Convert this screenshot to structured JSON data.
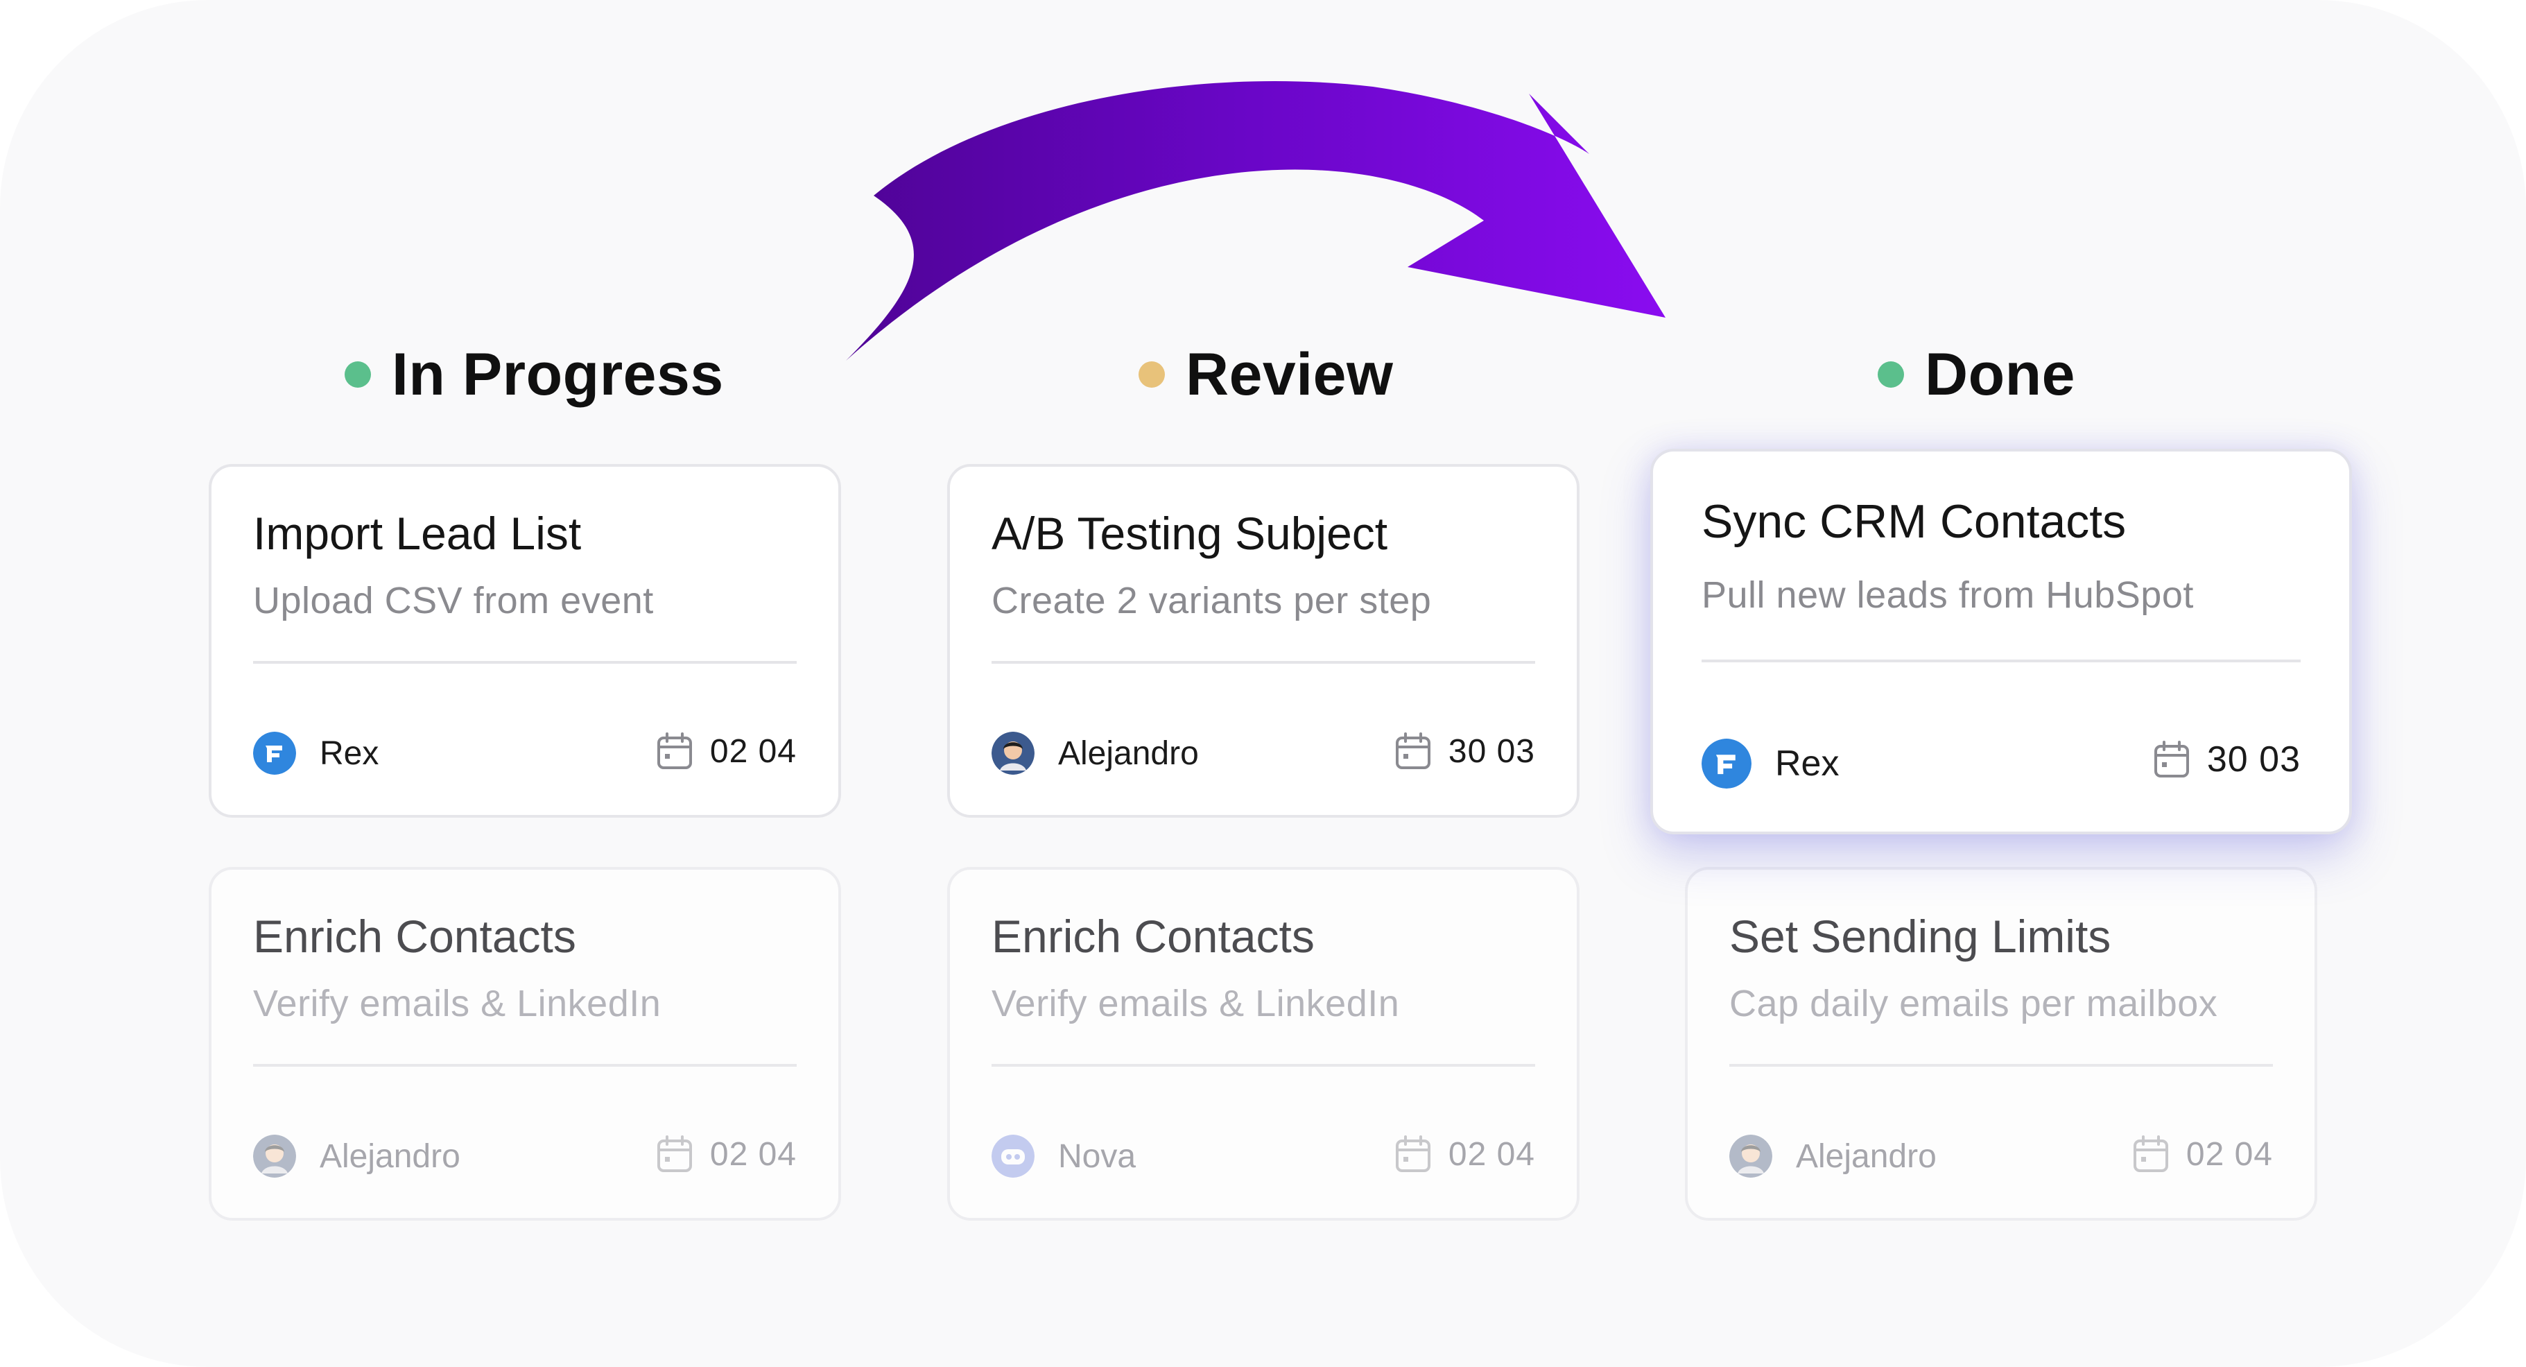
{
  "columns": [
    {
      "title": "In Progress",
      "dot_color": "#5bbf8c",
      "cards": [
        {
          "title": "Import Lead List",
          "subtitle": "Upload CSV from event",
          "assignee": "Rex",
          "avatar_icon": "rex-logo-icon",
          "date": "02 04"
        },
        {
          "title": "Enrich Contacts",
          "subtitle": "Verify emails & LinkedIn",
          "assignee": "Alejandro",
          "avatar_icon": "person-avatar-icon",
          "date": "02 04"
        }
      ]
    },
    {
      "title": "Review",
      "dot_color": "#e8c27a",
      "cards": [
        {
          "title": "A/B Testing Subject",
          "subtitle": "Create 2 variants per step",
          "assignee": "Alejandro",
          "avatar_icon": "person-avatar-icon",
          "date": "30 03"
        },
        {
          "title": "Enrich Contacts",
          "subtitle": "Verify emails & LinkedIn",
          "assignee": "Nova",
          "avatar_icon": "nova-logo-icon",
          "date": "02 04"
        }
      ]
    },
    {
      "title": "Done",
      "dot_color": "#5bbf8c",
      "cards": [
        {
          "title": "Sync CRM Contacts",
          "subtitle": "Pull new leads from HubSpot",
          "assignee": "Rex",
          "avatar_icon": "rex-logo-icon",
          "date": "30 03"
        },
        {
          "title": "Set Sending Limits",
          "subtitle": "Cap daily emails per mailbox",
          "assignee": "Alejandro",
          "avatar_icon": "person-avatar-icon",
          "date": "02 04"
        }
      ]
    }
  ],
  "arrow": {
    "icon": "move-arrow-icon",
    "color": "#7a0ae0"
  },
  "colors": {
    "rex_blue": "#2f86de",
    "nova_purple": "#7f8fe0",
    "calendar_gray": "#8a8a90"
  }
}
